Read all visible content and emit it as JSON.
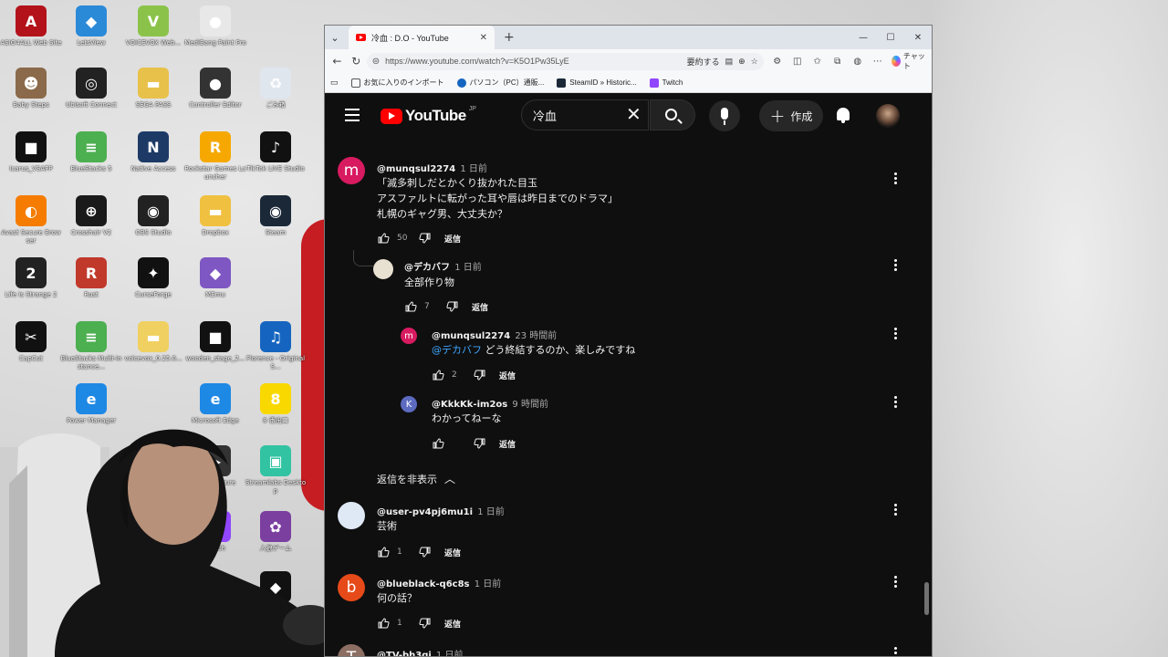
{
  "desktop": {
    "icons": [
      {
        "label": "ASIO4ALL Web Site",
        "glyph": "A",
        "color": "#b3121a"
      },
      {
        "label": "LetsView",
        "glyph": "◆",
        "color": "#2a8ad8"
      },
      {
        "label": "VOICEVOX Web...",
        "glyph": "V",
        "color": "#8bc34a"
      },
      {
        "label": "MediBang Paint Pro",
        "glyph": "●",
        "color": "#e8e8e8"
      },
      {
        "label": "Baby Steps",
        "glyph": "☻",
        "color": "#8a6a4a"
      },
      {
        "label": "Ubisoft Connect",
        "glyph": "◎",
        "color": "#222222"
      },
      {
        "label": "SEGA PASS",
        "glyph": "▬",
        "color": "#e8c14a"
      },
      {
        "label": "Controller Editor",
        "glyph": "●",
        "color": "#333333"
      },
      {
        "label": "ごみ箱",
        "glyph": "♻",
        "color": "#e0e6ee"
      },
      {
        "label": "Icarus_VSAPP",
        "glyph": "■",
        "color": "#111111"
      },
      {
        "label": "BlueStacks 5",
        "glyph": "≡",
        "color": "#4caf50"
      },
      {
        "label": "Native Access",
        "glyph": "N",
        "color": "#1d3a66"
      },
      {
        "label": "Rockstar Games Launcher",
        "glyph": "R",
        "color": "#f6a800"
      },
      {
        "label": "TikTok LIVE Studio",
        "glyph": "♪",
        "color": "#111111"
      },
      {
        "label": "Avast Secure Browser",
        "glyph": "◐",
        "color": "#f57c00"
      },
      {
        "label": "Crosshair V2",
        "glyph": "⊕",
        "color": "#1a1a1a"
      },
      {
        "label": "OBS Studio",
        "glyph": "◉",
        "color": "#222222"
      },
      {
        "label": "Dropbox",
        "glyph": "▬",
        "color": "#f0c040"
      },
      {
        "label": "Steam",
        "glyph": "◉",
        "color": "#1b2838"
      },
      {
        "label": "Life is Strange 2",
        "glyph": "2",
        "color": "#222222"
      },
      {
        "label": "Rust",
        "glyph": "R",
        "color": "#c0392b"
      },
      {
        "label": "CurseForge",
        "glyph": "✦",
        "color": "#111111"
      },
      {
        "label": "MEmu",
        "glyph": "◆",
        "color": "#7e57c2"
      },
      {
        "label": "CapCut",
        "glyph": "✂",
        "color": "#111111"
      },
      {
        "label": "BlueStacks Multi-Instance...",
        "glyph": "≡",
        "color": "#4caf50"
      },
      {
        "label": "voicevox_0.25.0...",
        "glyph": "▬",
        "color": "#f0d060"
      },
      {
        "label": "wooden_stage_2...",
        "glyph": "■",
        "color": "#111111"
      },
      {
        "label": "Florence - Original S...",
        "glyph": "♫",
        "color": "#1565c0"
      },
      {
        "label": "Power Manager",
        "glyph": "e",
        "color": "#1e88e5"
      },
      {
        "label": "Microsoft Edge",
        "glyph": "e",
        "color": "#1e88e5"
      },
      {
        "label": "8 番出口",
        "glyph": "8",
        "color": "#f9d800"
      },
      {
        "label": "Live Capture",
        "glyph": "▶",
        "color": "#333333"
      },
      {
        "label": "Streamlabs Desktop",
        "glyph": "▣",
        "color": "#31c3a2"
      },
      {
        "label": "Twitch",
        "glyph": "⌧",
        "color": "#9146ff"
      },
      {
        "label": "人狼ゲーム",
        "glyph": "✿",
        "color": "#7b3fa0"
      },
      {
        "label": "Roblox",
        "glyph": "◆",
        "color": "#111111"
      }
    ]
  },
  "browser": {
    "tab_title": "冷血 : D.O - YouTube",
    "url": "https://www.youtube.com/watch?v=K5O1Pw35LyE",
    "translate_label": "要約する",
    "chat_label": "チャット",
    "favorites": [
      {
        "label": "お気に入りのインポート",
        "color": "#555555"
      },
      {
        "label": "パソコン（PC）通販...",
        "color": "#1565c0"
      },
      {
        "label": "SteamID » Historic...",
        "color": "#1b2838"
      },
      {
        "label": "Twitch",
        "color": "#9146ff"
      }
    ]
  },
  "youtube": {
    "logo_word": "YouTube",
    "logo_region": "JP",
    "search_value": "冷血",
    "create_label": "作成",
    "comments": [
      {
        "author": "@munqsul2274",
        "time": "1 日前",
        "lines": [
          "「滅多刺しだとかくり抜かれた目玉",
          "アスファルトに転がった耳や唇は昨日までのドラマ」",
          "札幌のギャグ男、大丈夫か？"
        ],
        "likes": "50",
        "reply": "返信",
        "avatar_letter": "m",
        "avatar_color": "#d81b60"
      },
      {
        "author": "@デカバフ",
        "time": "1 日前",
        "lines": [
          "全部作り物"
        ],
        "likes": "7",
        "reply": "返信",
        "avatar_letter": "",
        "avatar_color": "#e8e0d0"
      },
      {
        "author": "@munqsul2274",
        "time": "23 時間前",
        "mention": "@デカバフ",
        "text_after": " どう終結するのか、楽しみですね",
        "likes": "2",
        "reply": "返信",
        "avatar_letter": "m",
        "avatar_color": "#d81b60"
      },
      {
        "author": "@KkkKk-im2os",
        "time": "9 時間前",
        "lines": [
          "わかってねーな"
        ],
        "likes": "",
        "reply": "返信",
        "avatar_letter": "K",
        "avatar_color": "#5c6bc0"
      },
      {
        "author": "@user-pv4pj6mu1i",
        "time": "1 日前",
        "lines": [
          "芸術"
        ],
        "likes": "1",
        "reply": "返信",
        "avatar_letter": "",
        "avatar_color": "#dfe8f5"
      },
      {
        "author": "@blueblack-q6c8s",
        "time": "1 日前",
        "lines": [
          "何の話？"
        ],
        "likes": "1",
        "reply": "返信",
        "avatar_letter": "b",
        "avatar_color": "#e64a19"
      },
      {
        "author": "@TV-bh3qi",
        "time": "1 日前",
        "lines": [],
        "likes": "",
        "reply": "",
        "avatar_letter": "T",
        "avatar_color": "#8d6e63"
      }
    ],
    "hide_replies_label": "返信を非表示"
  }
}
